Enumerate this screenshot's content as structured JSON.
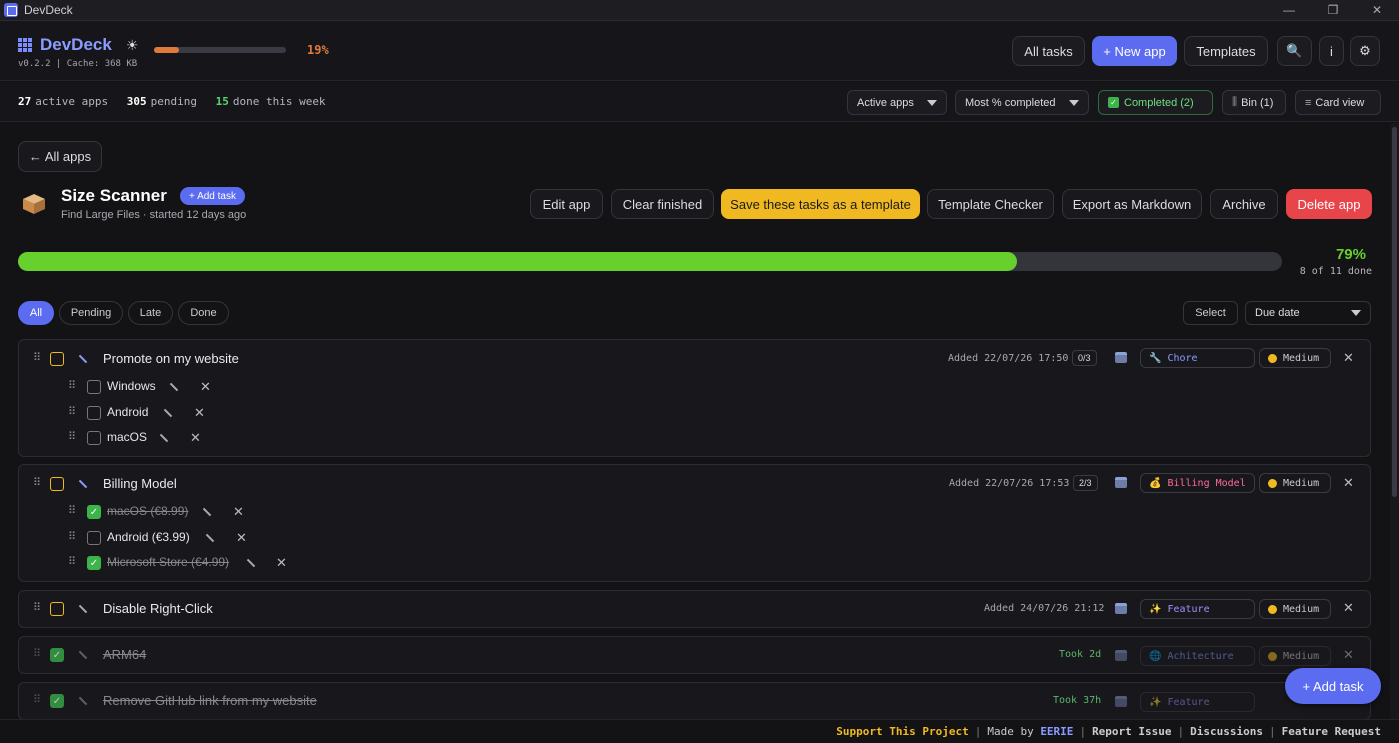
{
  "window": {
    "title": "DevDeck"
  },
  "header": {
    "brand": "DevDeck",
    "version": "v0.2.2 | Cache: 368 KB",
    "progress_pct": 19,
    "progress_label": "19%",
    "all_tasks": "All tasks",
    "new_app": "+ New app",
    "templates": "Templates",
    "info": "i"
  },
  "stats": {
    "active_count": "27",
    "active_label": "active apps",
    "pending_count": "305",
    "pending_label": "pending",
    "done_count": "15",
    "done_label": "done this week",
    "filter_select": "Active apps",
    "sort_select": "Most % completed",
    "completed": "Completed (2)",
    "bin": "Bin (1)",
    "view": "Card view"
  },
  "app": {
    "back": "← All apps",
    "name": "Size Scanner",
    "subtitle": "Find Large Files · started 12 days ago",
    "add_task": "+ Add task",
    "actions": {
      "edit": "Edit app",
      "clear": "Clear finished",
      "save_template": "Save these tasks as a template",
      "checker": "Template Checker",
      "export": "Export as Markdown",
      "archive": "Archive",
      "delete": "Delete app"
    },
    "progress_pct": 79,
    "progress_label": "79%",
    "progress_sub": "8 of 11 done"
  },
  "filters": {
    "all": "All",
    "pending": "Pending",
    "late": "Late",
    "done": "Done",
    "select": "Select",
    "sort": "Due date"
  },
  "tasks": [
    {
      "title": "Promote on my website",
      "added": "Added 22/07/26 17:50",
      "count": "0/3",
      "tag": "Chore",
      "tag_color": "#8b9bff",
      "priority": "Medium",
      "subtasks": [
        {
          "label": "Windows"
        },
        {
          "label": "Android"
        },
        {
          "label": "macOS"
        }
      ]
    },
    {
      "title": "Billing Model",
      "added": "Added 22/07/26 17:53",
      "count": "2/3",
      "tag": "Billing Model",
      "tag_color": "#ff6b9a",
      "priority": "Medium",
      "subtasks": [
        {
          "label": "macOS (€8.99)"
        },
        {
          "label": "Android (€3.99)"
        },
        {
          "label": "Microsoft Store (€4.99)"
        }
      ]
    },
    {
      "title": "Disable Right-Click",
      "added": "Added 24/07/26 21:12",
      "tag": "Feature",
      "tag_color": "#a88bff",
      "priority": "Medium"
    },
    {
      "title": "ARM64",
      "took": "Took 2d",
      "tag": "Achitecture",
      "tag_color": "#8b9bff",
      "priority": "Medium"
    },
    {
      "title": "Remove GitHub link from my website",
      "took": "Took 37h",
      "tag": "Feature",
      "tag_color": "#a88bff",
      "priority": "Medium"
    }
  ],
  "fab": "+ Add task",
  "footer": {
    "support": "Support This Project",
    "made_by": "Made by",
    "author": "EERIE",
    "report": "Report Issue",
    "discussions": "Discussions",
    "feature": "Feature Request"
  },
  "colors": {
    "accent": "#5b6cf0",
    "progress_green": "#67d02c",
    "progress_orange": "#e07a3a",
    "danger": "#e8454b",
    "warning": "#f0b922"
  }
}
